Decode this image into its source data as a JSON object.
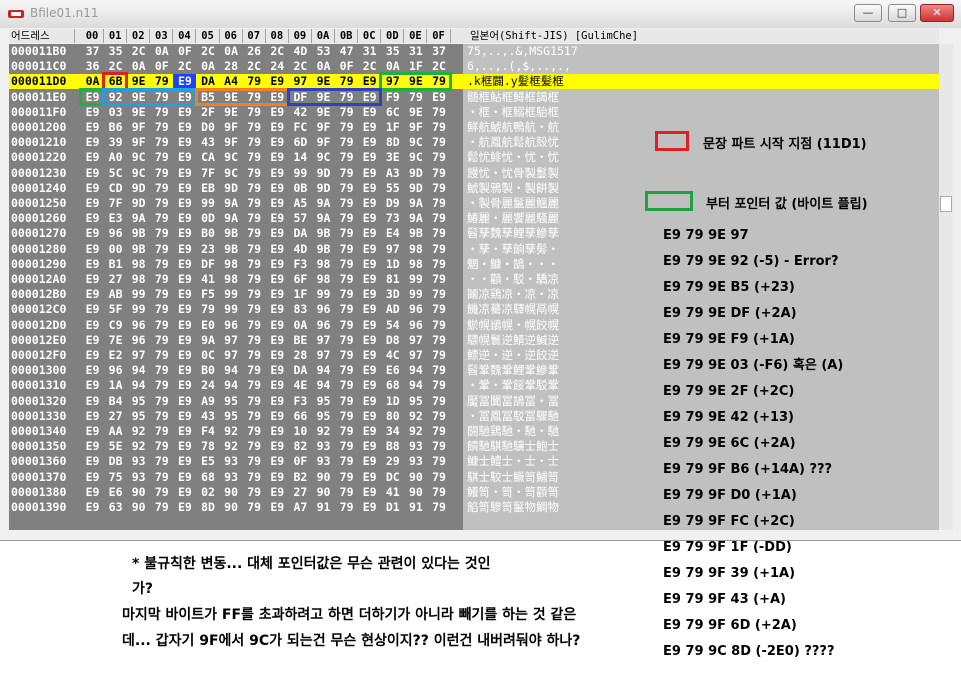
{
  "window": {
    "title": "Bfile01.n11",
    "minimize": "—",
    "maximize": "□",
    "close": "✕"
  },
  "hex_header": {
    "address_label": "어드레스",
    "columns": [
      "00",
      "01",
      "02",
      "03",
      "04",
      "05",
      "06",
      "07",
      "08",
      "09",
      "0A",
      "0B",
      "0C",
      "0D",
      "0E",
      "0F"
    ],
    "text_label": "일본어(Shift-JIS) [GulimChe]"
  },
  "rows": [
    {
      "addr": "000011B0",
      "bytes": [
        "37",
        "35",
        "2C",
        "0A",
        "0F",
        "2C",
        "0A",
        "26",
        "2C",
        "4D",
        "53",
        "47",
        "31",
        "35",
        "31",
        "37"
      ],
      "text": "75,..,.&,MSG1517"
    },
    {
      "addr": "000011C0",
      "bytes": [
        "36",
        "2C",
        "0A",
        "0F",
        "2C",
        "0A",
        "28",
        "2C",
        "24",
        "2C",
        "0A",
        "0F",
        "2C",
        "0A",
        "1F",
        "2C"
      ],
      "text": "6,..,.(,$,..,.,"
    },
    {
      "addr": "000011D0",
      "bytes": [
        "0A",
        "6B",
        "9E",
        "79",
        "E9",
        "DA",
        "A4",
        "79",
        "E9",
        "97",
        "9E",
        "79",
        "E9",
        "97",
        "9E",
        "79"
      ],
      "text": ".k框闢.y髪框髪框"
    },
    {
      "addr": "000011E0",
      "bytes": [
        "E9",
        "92",
        "9E",
        "79",
        "E9",
        "B5",
        "9E",
        "79",
        "E9",
        "DF",
        "9E",
        "79",
        "E9",
        "F9",
        "79",
        "E9"
      ],
      "text": "髄框鮎框鱘框謁框"
    },
    {
      "addr": "000011F0",
      "bytes": [
        "E9",
        "03",
        "9E",
        "79",
        "E9",
        "2F",
        "9E",
        "79",
        "E9",
        "42",
        "9E",
        "79",
        "E9",
        "6C",
        "9E",
        "79"
      ],
      "text": "・框・框鰯框駘框"
    },
    {
      "addr": "00001200",
      "bytes": [
        "E9",
        "B6",
        "9F",
        "79",
        "E9",
        "D0",
        "9F",
        "79",
        "E9",
        "FC",
        "9F",
        "79",
        "E9",
        "1F",
        "9F",
        "79"
      ],
      "text": "鮮航鯱航鴨航・航"
    },
    {
      "addr": "00001210",
      "bytes": [
        "E9",
        "39",
        "9F",
        "79",
        "E9",
        "43",
        "9F",
        "79",
        "E9",
        "6D",
        "9F",
        "79",
        "E9",
        "8D",
        "9C",
        "79"
      ],
      "text": "・航鳳航鬆航殻忧"
    },
    {
      "addr": "00001220",
      "bytes": [
        "E9",
        "A0",
        "9C",
        "79",
        "E9",
        "CA",
        "9C",
        "79",
        "E9",
        "14",
        "9C",
        "79",
        "E9",
        "3E",
        "9C",
        "79"
      ],
      "text": "鬆忧鯡忧・忧・忧"
    },
    {
      "addr": "00001230",
      "bytes": [
        "E9",
        "5C",
        "9C",
        "79",
        "E9",
        "7F",
        "9C",
        "79",
        "E9",
        "99",
        "9D",
        "79",
        "E9",
        "A3",
        "9D",
        "79"
      ],
      "text": "饅忧・忧骨製鬘製"
    },
    {
      "addr": "00001240",
      "bytes": [
        "E9",
        "CD",
        "9D",
        "79",
        "E9",
        "EB",
        "9D",
        "79",
        "E9",
        "0B",
        "9D",
        "79",
        "E9",
        "55",
        "9D",
        "79"
      ],
      "text": "鯱製鴉製・製餠製"
    },
    {
      "addr": "00001250",
      "bytes": [
        "E9",
        "7F",
        "9D",
        "79",
        "E9",
        "99",
        "9A",
        "79",
        "E9",
        "A5",
        "9A",
        "79",
        "E9",
        "D9",
        "9A",
        "79"
      ],
      "text": "・製骨麗鬣麗鰮麗"
    },
    {
      "addr": "00001260",
      "bytes": [
        "E9",
        "E3",
        "9A",
        "79",
        "E9",
        "0D",
        "9A",
        "79",
        "E9",
        "57",
        "9A",
        "79",
        "E9",
        "73",
        "9A",
        "79"
      ],
      "text": "鰆麗・麗饗麗騒麗"
    },
    {
      "addr": "00001270",
      "bytes": [
        "E9",
        "96",
        "9B",
        "79",
        "E9",
        "B0",
        "9B",
        "79",
        "E9",
        "DA",
        "9B",
        "79",
        "E9",
        "E4",
        "9B",
        "79"
      ],
      "text": "髫孳魏孳鯉孳鰺孳"
    },
    {
      "addr": "00001280",
      "bytes": [
        "E9",
        "00",
        "9B",
        "79",
        "E9",
        "23",
        "9B",
        "79",
        "E9",
        "4D",
        "9B",
        "79",
        "E9",
        "97",
        "98",
        "79"
      ],
      "text": "・孳・孳餉孳髣・"
    },
    {
      "addr": "00001290",
      "bytes": [
        "E9",
        "B1",
        "98",
        "79",
        "E9",
        "DF",
        "98",
        "79",
        "E9",
        "F3",
        "98",
        "79",
        "E9",
        "1D",
        "98",
        "79"
      ],
      "text": "魍・鱇・鵠・・・"
    },
    {
      "addr": "000012A0",
      "bytes": [
        "E9",
        "27",
        "98",
        "79",
        "E9",
        "41",
        "98",
        "79",
        "E9",
        "6F",
        "98",
        "79",
        "E9",
        "81",
        "99",
        "79"
      ],
      "text": "・・顴・駁・驕凉"
    },
    {
      "addr": "000012B0",
      "bytes": [
        "E9",
        "AB",
        "99",
        "79",
        "E9",
        "F5",
        "99",
        "79",
        "E9",
        "1F",
        "99",
        "79",
        "E9",
        "3D",
        "99",
        "79"
      ],
      "text": "鬮凉鶏凉・凉・凉"
    },
    {
      "addr": "000012C0",
      "bytes": [
        "E9",
        "5F",
        "99",
        "79",
        "E9",
        "79",
        "99",
        "79",
        "E9",
        "83",
        "96",
        "79",
        "E9",
        "AD",
        "96",
        "79"
      ],
      "text": "饑凉驀凉驛幌鬲幌"
    },
    {
      "addr": "000012D0",
      "bytes": [
        "E9",
        "C9",
        "96",
        "79",
        "E9",
        "E0",
        "96",
        "79",
        "E9",
        "0A",
        "96",
        "79",
        "E9",
        "54",
        "96",
        "79"
      ],
      "text": "鯲幌鶲幌・幌餃幌"
    },
    {
      "addr": "000012E0",
      "bytes": [
        "E9",
        "7E",
        "96",
        "79",
        "E9",
        "9A",
        "97",
        "79",
        "E9",
        "BE",
        "97",
        "79",
        "E9",
        "D8",
        "97",
        "79"
      ],
      "text": "驃幌鬟逆鯖逆鰔逆"
    },
    {
      "addr": "000012F0",
      "bytes": [
        "E9",
        "E2",
        "97",
        "79",
        "E9",
        "0C",
        "97",
        "79",
        "E9",
        "28",
        "97",
        "79",
        "E9",
        "4C",
        "97",
        "79"
      ],
      "text": "鰾逆・逆・逆餃逆"
    },
    {
      "addr": "00001300",
      "bytes": [
        "E9",
        "96",
        "94",
        "79",
        "E9",
        "B0",
        "94",
        "79",
        "E9",
        "DA",
        "94",
        "79",
        "E9",
        "E6",
        "94",
        "79"
      ],
      "text": "髫鞏魏鞏鯉鞏鰺鞏"
    },
    {
      "addr": "00001310",
      "bytes": [
        "E9",
        "1A",
        "94",
        "79",
        "E9",
        "24",
        "94",
        "79",
        "E9",
        "4E",
        "94",
        "79",
        "E9",
        "68",
        "94",
        "79"
      ],
      "text": "・鞏・鞏餒鞏駁鞏"
    },
    {
      "addr": "00001320",
      "bytes": [
        "E9",
        "B4",
        "95",
        "79",
        "E9",
        "A9",
        "95",
        "79",
        "E9",
        "F3",
        "95",
        "79",
        "E9",
        "1D",
        "95",
        "79"
      ],
      "text": "魘冨闐冨鵠冨・冨"
    },
    {
      "addr": "00001330",
      "bytes": [
        "E9",
        "27",
        "95",
        "79",
        "E9",
        "43",
        "95",
        "79",
        "E9",
        "66",
        "95",
        "79",
        "E9",
        "80",
        "92",
        "79"
      ],
      "text": "・冨鳳冨駁冨驟馳"
    },
    {
      "addr": "00001340",
      "bytes": [
        "E9",
        "AA",
        "92",
        "79",
        "E9",
        "F4",
        "92",
        "79",
        "E9",
        "10",
        "92",
        "79",
        "E9",
        "34",
        "92",
        "79"
      ],
      "text": "闘馳鶏馳・馳・馳"
    },
    {
      "addr": "00001350",
      "bytes": [
        "E9",
        "5E",
        "92",
        "79",
        "E9",
        "78",
        "92",
        "79",
        "E9",
        "82",
        "93",
        "79",
        "E9",
        "B8",
        "93",
        "79"
      ],
      "text": "饋馳騏馳驥士鮑士"
    },
    {
      "addr": "00001360",
      "bytes": [
        "E9",
        "DB",
        "93",
        "79",
        "E9",
        "E5",
        "93",
        "79",
        "E9",
        "0F",
        "93",
        "79",
        "E9",
        "29",
        "93",
        "79"
      ],
      "text": "鱇士鱧士・士・士"
    },
    {
      "addr": "00001370",
      "bytes": [
        "E9",
        "75",
        "93",
        "79",
        "E9",
        "68",
        "93",
        "79",
        "E9",
        "B2",
        "90",
        "79",
        "E9",
        "DC",
        "90",
        "79"
      ],
      "text": "騏士駮士鱖笥鯆笥"
    },
    {
      "addr": "00001380",
      "bytes": [
        "E9",
        "E6",
        "90",
        "79",
        "E9",
        "02",
        "90",
        "79",
        "E9",
        "27",
        "90",
        "79",
        "E9",
        "41",
        "90",
        "79"
      ],
      "text": "鱶笥・笥・笥顴笥"
    },
    {
      "addr": "00001390",
      "bytes": [
        "E9",
        "63",
        "90",
        "79",
        "E9",
        "8D",
        "90",
        "79",
        "E9",
        "A7",
        "91",
        "79",
        "E9",
        "D1",
        "91",
        "79"
      ],
      "text": "餡笥驂笥鬣物鯛物"
    }
  ],
  "highlighted_row": 2,
  "legend": [
    {
      "color": "#e02020",
      "label": "문장 파트 시작 지점 (11D1)"
    },
    {
      "color": "#20a040",
      "label": "부터 포인터 값  (바이트 플립)"
    }
  ],
  "box_colors": {
    "red": "#e02020",
    "green": "#20b040",
    "cyan": "#20a0e0",
    "orange": "#f08020",
    "indigo": "#3040c0"
  },
  "pointer_values": [
    "E9 79 9E 97",
    "E9 79 9E 92 (-5)   - Error?",
    "E9 79 9E B5 (+23)",
    "E9 79 9E DF (+2A)",
    "E9 79 9E F9 (+1A)",
    "E9 79 9E 03 (-F6)      혹은 (A)",
    "E9 79 9E 2F (+2C)",
    "E9 79 9E 42 (+13)",
    "E9 79 9E 6C (+2A)",
    "E9 79 9F B6 (+14A) ???",
    "E9 79 9F D0 (+1A)",
    "E9 79 9F FC (+2C)",
    "E9 79 9F 1F (-DD)",
    "E9 79 9F 39 (+1A)",
    "E9 79 9F 43 (+A)",
    "E9 79 9F 6D (+2A)",
    "E9 79 9C 8D (-2E0) ????"
  ],
  "notes": [
    "* 불규칙한 변동... 대체 포인터값은 무슨 관련이 있다는 것인",
    "가?",
    "마지막 바이트가 FF를 초과하려고 하면 더하기가 아니라 빼기를 하는 것 같은",
    "데... 갑자기 9F에서 9C가 되는건 무슨 현상이지?? 이런건 내버려둬야 하나?"
  ]
}
